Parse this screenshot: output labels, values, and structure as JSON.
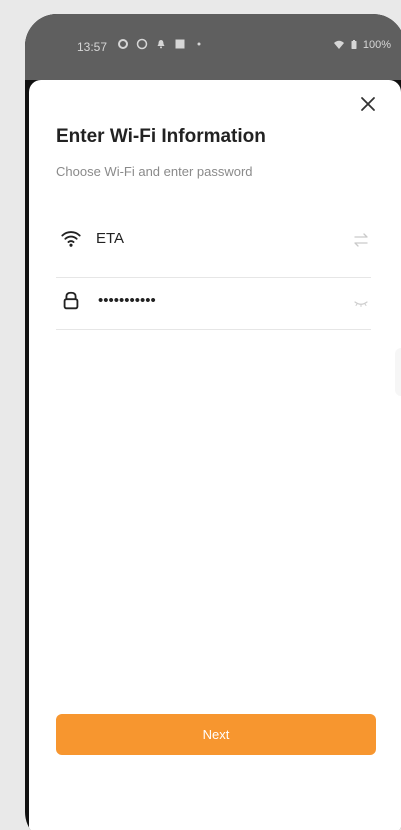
{
  "status_bar": {
    "time": "13:57",
    "battery": "100%"
  },
  "dialog": {
    "title": "Enter Wi-Fi Information",
    "subtitle": "Choose Wi-Fi and enter password",
    "ssid_value": "ETA",
    "password_value": "•••••••••••",
    "next_label": "Next"
  },
  "colors": {
    "accent": "#f7962f",
    "status_bar_bg": "#5f5f5f",
    "sheet_bg": "#ffffff"
  },
  "icons": {
    "close": "close-icon",
    "wifi": "wifi-icon",
    "lock": "lock-icon",
    "switch": "switch-network-icon",
    "visibility": "visibility-toggle-icon"
  }
}
